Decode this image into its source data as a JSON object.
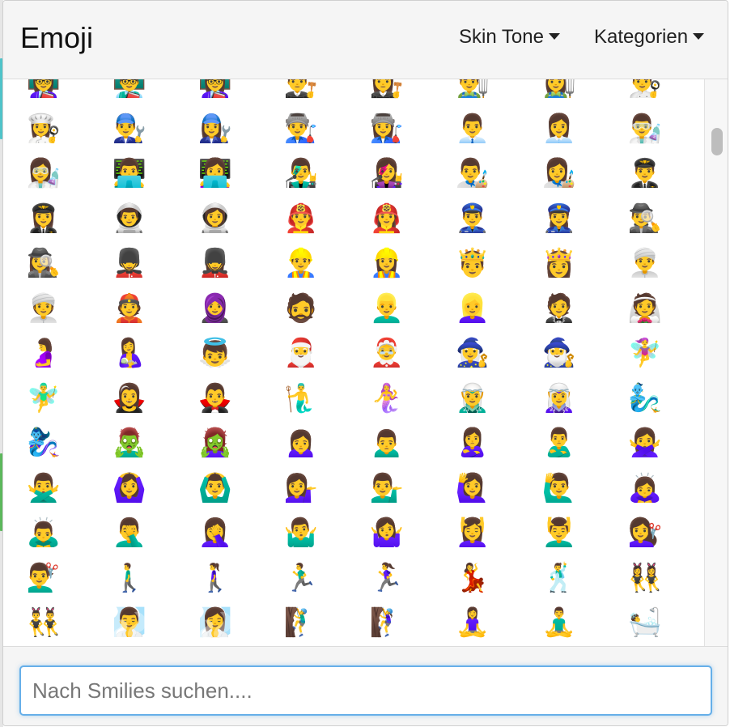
{
  "header": {
    "title": "Emoji",
    "skin_tone_label": "Skin Tone",
    "categories_label": "Kategorien"
  },
  "search": {
    "placeholder": "Nach Smilies suchen...."
  },
  "emoji_rows": [
    [
      "👩‍🏫",
      "👨‍🏫",
      "👩‍🏫",
      "👨‍⚖️",
      "👩‍⚖️",
      "👨‍🌾",
      "👩‍🌾",
      "👨‍🍳"
    ],
    [
      "👩‍🍳",
      "👨‍🔧",
      "👩‍🔧",
      "👨‍🏭",
      "👩‍🏭",
      "👨‍💼",
      "👩‍💼",
      "👨‍🔬"
    ],
    [
      "👩‍🔬",
      "👨‍💻",
      "👩‍💻",
      "👨‍🎤",
      "👩‍🎤",
      "👨‍🎨",
      "👩‍🎨",
      "👨‍✈️"
    ],
    [
      "👩‍✈️",
      "👨‍🚀",
      "👩‍🚀",
      "👨‍🚒",
      "👩‍🚒",
      "👮‍♂️",
      "👮‍♀️",
      "🕵️‍♂️"
    ],
    [
      "🕵️‍♀️",
      "💂‍♂️",
      "💂‍♀️",
      "👷‍♂️",
      "👷‍♀️",
      "🤴",
      "👸",
      "👳‍♂️"
    ],
    [
      "👳‍♀️",
      "👲",
      "🧕",
      "🧔",
      "👱‍♂️",
      "👱‍♀️",
      "🤵",
      "👰"
    ],
    [
      "🤰",
      "🤱",
      "👼",
      "🎅",
      "🤶",
      "🧙‍♀️",
      "🧙‍♂️",
      "🧚‍♀️"
    ],
    [
      "🧚‍♂️",
      "🧛‍♀️",
      "🧛‍♂️",
      "🧜‍♂️",
      "🧜‍♀️",
      "🧝‍♂️",
      "🧝‍♀️",
      "🧞‍♂️"
    ],
    [
      "🧞‍♀️",
      "🧟‍♂️",
      "🧟‍♀️",
      "🙍‍♀️",
      "🙍‍♂️",
      "🙎‍♀️",
      "🙎‍♂️",
      "🙅‍♀️"
    ],
    [
      "🙅‍♂️",
      "🙆‍♀️",
      "🙆‍♂️",
      "💁‍♀️",
      "💁‍♂️",
      "🙋‍♀️",
      "🙋‍♂️",
      "🙇‍♀️"
    ],
    [
      "🙇‍♂️",
      "🤦‍♂️",
      "🤦‍♀️",
      "🤷‍♂️",
      "🤷‍♀️",
      "💆‍♀️",
      "💆‍♂️",
      "💇‍♀️"
    ],
    [
      "💇‍♂️",
      "🚶‍♂️",
      "🚶‍♀️",
      "🏃‍♂️",
      "🏃‍♀️",
      "💃",
      "🕺",
      "👯‍♀️"
    ],
    [
      "👯‍♂️",
      "🧖‍♂️",
      "🧖‍♀️",
      "🧗‍♂️",
      "🧗‍♀️",
      "🧘‍♀️",
      "🧘‍♂️",
      "🛀"
    ]
  ]
}
